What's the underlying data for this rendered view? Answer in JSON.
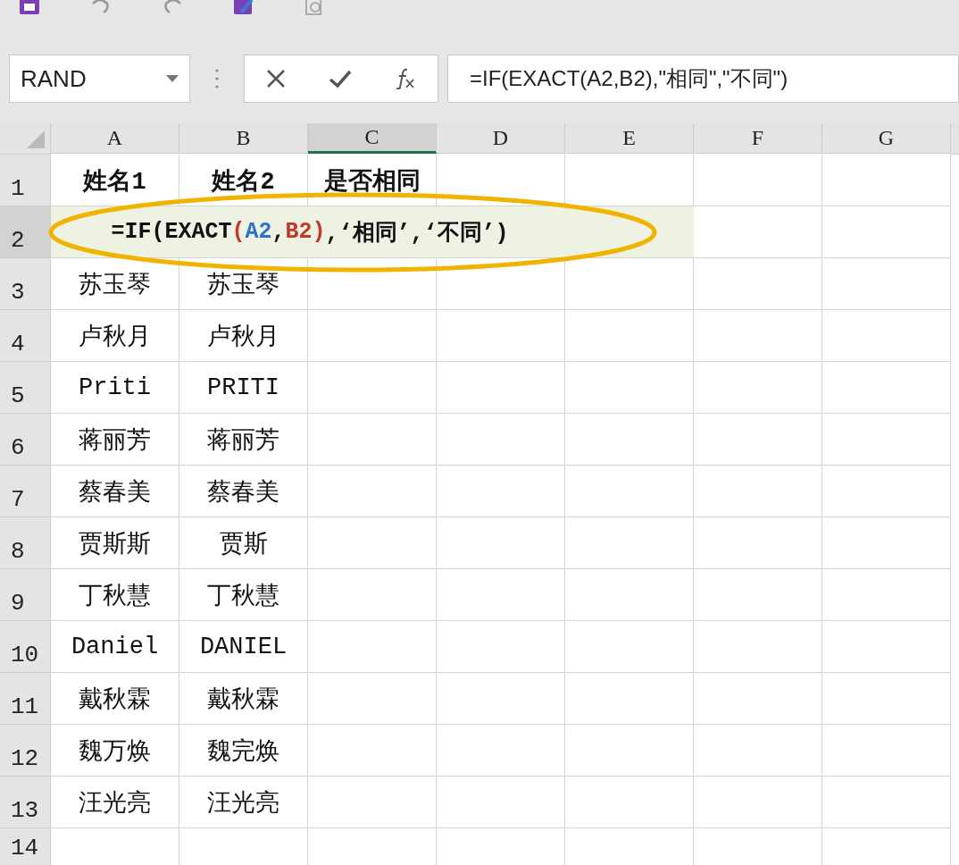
{
  "formula_bar": {
    "name_box": "RAND",
    "formula": "=IF(EXACT(A2,B2),\"相同\",\"不同\")"
  },
  "columns": [
    {
      "label": "A",
      "selected": false
    },
    {
      "label": "B",
      "selected": false
    },
    {
      "label": "C",
      "selected": true
    },
    {
      "label": "D",
      "selected": false
    },
    {
      "label": "E",
      "selected": false
    },
    {
      "label": "F",
      "selected": false
    },
    {
      "label": "G",
      "selected": false
    }
  ],
  "rows": [
    {
      "number": "1",
      "selected": false,
      "kind": "header",
      "cells": [
        "姓名1",
        "姓名2",
        "是否相同"
      ]
    },
    {
      "number": "2",
      "selected": true,
      "kind": "editing",
      "segments": [
        {
          "text": "=IF(EXACT",
          "color": "#111111"
        },
        {
          "text": "(",
          "color": "#c0392b"
        },
        {
          "text": "A2",
          "color": "#2f6fd0"
        },
        {
          "text": ", ",
          "color": "#111111"
        },
        {
          "text": "B2",
          "color": "#c0392b"
        },
        {
          "text": ")",
          "color": "#c0392b"
        },
        {
          "text": ",‘相同’,‘不同’)",
          "color": "#111111"
        }
      ]
    },
    {
      "number": "3",
      "selected": false,
      "kind": "data",
      "cells": [
        "苏玉琴",
        "苏玉琴"
      ]
    },
    {
      "number": "4",
      "selected": false,
      "kind": "data",
      "cells": [
        "卢秋月",
        "卢秋月"
      ]
    },
    {
      "number": "5",
      "selected": false,
      "kind": "data",
      "cells": [
        "Priti",
        "PRITI"
      ]
    },
    {
      "number": "6",
      "selected": false,
      "kind": "data",
      "cells": [
        "蒋丽芳",
        "蒋丽芳"
      ]
    },
    {
      "number": "7",
      "selected": false,
      "kind": "data",
      "cells": [
        "蔡春美",
        "蔡春美"
      ]
    },
    {
      "number": "8",
      "selected": false,
      "kind": "data",
      "cells": [
        "贾斯斯",
        "贾斯"
      ]
    },
    {
      "number": "9",
      "selected": false,
      "kind": "data",
      "cells": [
        "丁秋慧",
        "丁秋慧"
      ]
    },
    {
      "number": "10",
      "selected": false,
      "kind": "data",
      "cells": [
        "Daniel",
        "DANIEL"
      ]
    },
    {
      "number": "11",
      "selected": false,
      "kind": "data",
      "cells": [
        "戴秋霖",
        "戴秋霖"
      ]
    },
    {
      "number": "12",
      "selected": false,
      "kind": "data",
      "cells": [
        "魏万焕",
        "魏完焕"
      ]
    },
    {
      "number": "13",
      "selected": false,
      "kind": "data",
      "cells": [
        "汪光亮",
        "汪光亮"
      ]
    },
    {
      "number": "14",
      "selected": false,
      "kind": "data",
      "cells": []
    }
  ]
}
